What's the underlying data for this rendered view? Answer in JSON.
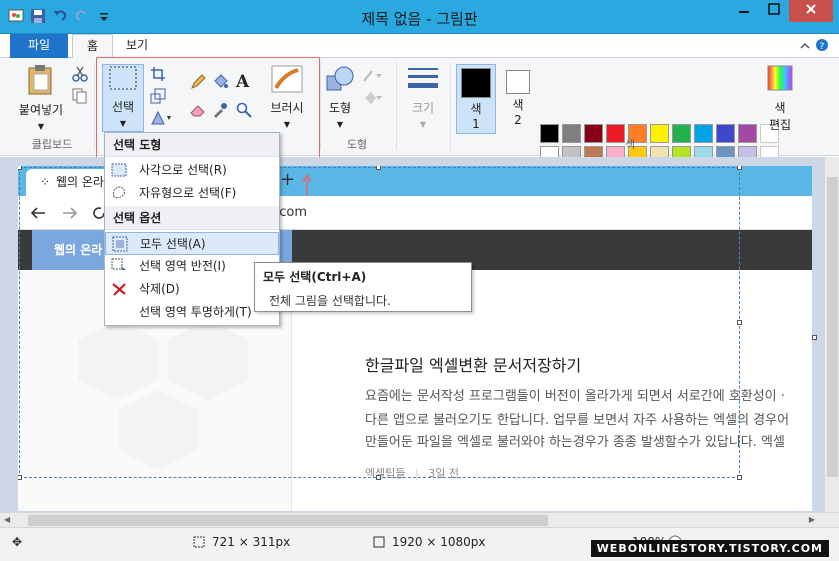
{
  "window": {
    "title": "제목 없음 - 그림판"
  },
  "tabs": {
    "file": "파일",
    "home": "홈",
    "view": "보기"
  },
  "ribbon": {
    "paste_label": "붙여넣기",
    "clipboard_group": "클립보드",
    "select_label": "선택",
    "brush_label": "브러시",
    "shapes_label": "도형",
    "shapes_group": "도형",
    "size_label": "크기",
    "color1_label": "색",
    "color1_num": "1",
    "color2_label": "색",
    "color2_num": "2",
    "edit_colors_label_1": "색",
    "edit_colors_label_2": "편집",
    "colors_group": "색"
  },
  "palette": {
    "row1": [
      "#000000",
      "#7f7f7f",
      "#880015",
      "#ed1c24",
      "#ff7f27",
      "#fff200",
      "#22b14c",
      "#00a2e8",
      "#3f48cc",
      "#a349a4"
    ],
    "row2": [
      "#ffffff",
      "#c3c3c3",
      "#b97a57",
      "#ffaec9",
      "#ffc90e",
      "#efe4b0",
      "#b5e61d",
      "#99d9ea",
      "#7092be",
      "#c8bfe7"
    ]
  },
  "dropdown": {
    "header_shape": "선택 도형",
    "rect_select": "사각으로 선택(R)",
    "free_select": "자유형으로 선택(F)",
    "header_options": "선택 옵션",
    "select_all": "모두 선택(A)",
    "invert": "선택 영역 반전(I)",
    "delete": "삭제(D)",
    "transparent": "선택 영역 투명하게(T)"
  },
  "tooltip": {
    "title": "모두 선택(Ctrl+A)",
    "desc": "전체 그림을 선택합니다."
  },
  "canvas": {
    "tab_text": "웹의 온라",
    "address": "ory.com",
    "brand": "웹의 온라",
    "article_title": "한글파일 엑셀변환 문서저장하기",
    "line1": "요즘에는 문서작성 프로그램들이 버전이 올라가게 되면서 서로간에 호환성이 ·",
    "line2": "다른 앱으로 불러오기도 한답니다. 업무를 보면서 자주 사용하는 엑셀의 경우어",
    "line3": "만들어둔 파일을 엑셀로 불러와야 하는경우가 종종 발생할수가 있답니다. 엑셀",
    "meta_tag": "엑셀팁들",
    "meta_sep": "|",
    "meta_time": "3일 전"
  },
  "status": {
    "selection_size": "721 × 311px",
    "image_size": "1920 × 1080px",
    "zoom": "100%",
    "watermark": "WEBONLINESTORY.TISTORY.COM"
  }
}
